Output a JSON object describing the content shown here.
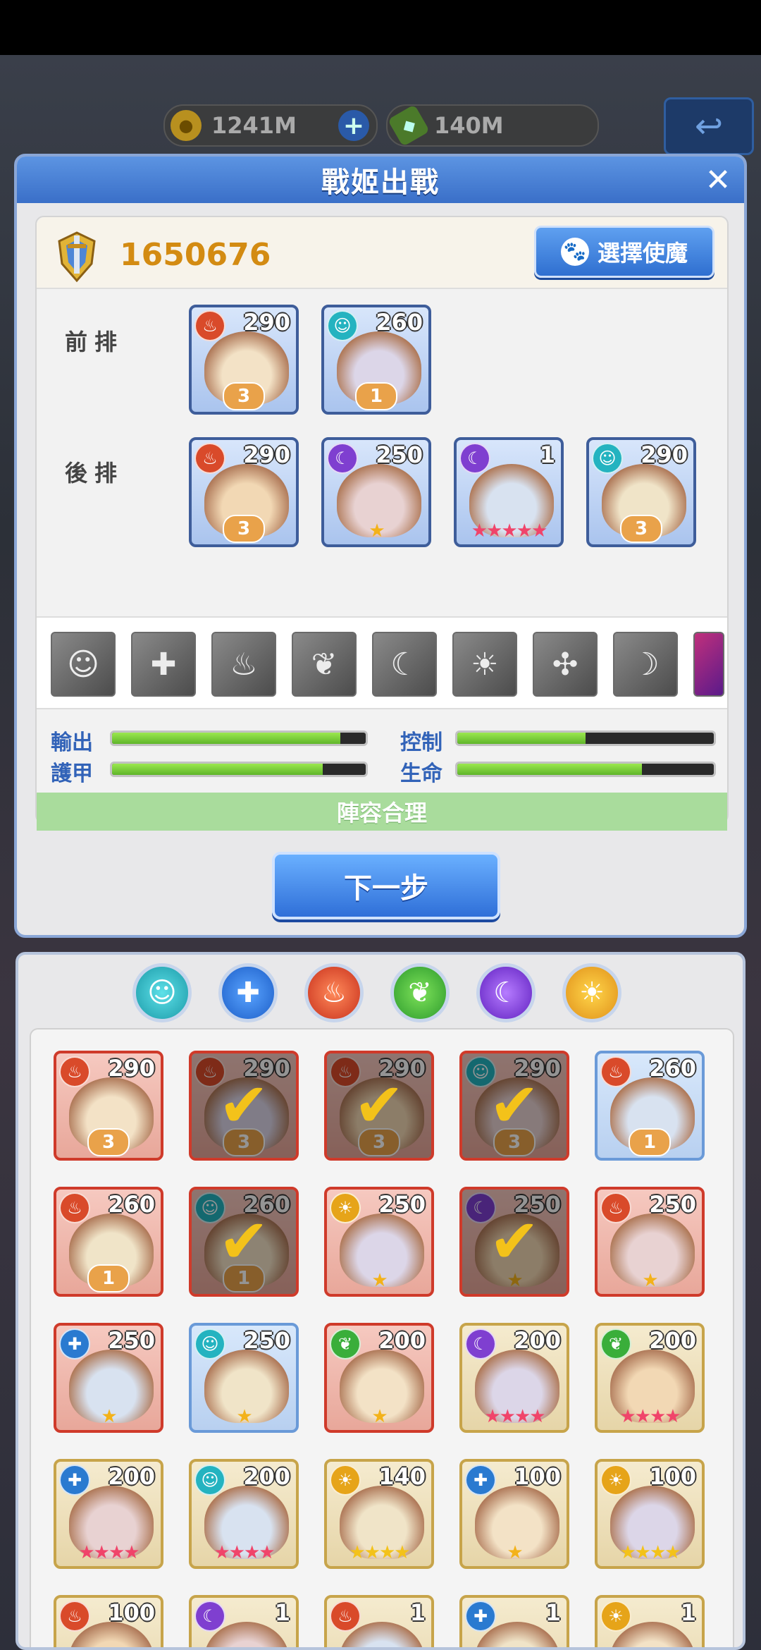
{
  "resources": {
    "gold": "1241M",
    "gems": "140M"
  },
  "panel": {
    "title": "戰姬出戰",
    "power": "1650676",
    "pet_button": "選擇使魔",
    "front_label": "前排",
    "back_label": "後排",
    "next_button": "下一步",
    "verdict": "陣容合理"
  },
  "front_row": [
    {
      "element": "fire",
      "level": "290",
      "rank": "3"
    },
    {
      "element": "water",
      "level": "260",
      "rank": "1"
    }
  ],
  "back_row": [
    {
      "element": "fire",
      "level": "290",
      "rank": "3"
    },
    {
      "element": "dark",
      "level": "250",
      "stars": "★"
    },
    {
      "element": "dark",
      "level": "1",
      "stars": "★★★★★"
    },
    {
      "element": "water",
      "level": "290",
      "rank": "3"
    }
  ],
  "skills": [
    "ghost-icon",
    "shield-cross-icon",
    "flame-icon",
    "leaf-icon",
    "moon-icon",
    "sun-icon",
    "swirl-icon",
    "moon-sun-icon"
  ],
  "stats": {
    "output": {
      "label": "輸出",
      "value": 0.9
    },
    "control": {
      "label": "控制",
      "value": 0.5
    },
    "armor": {
      "label": "護甲",
      "value": 0.83
    },
    "life": {
      "label": "生命",
      "value": 0.72
    }
  },
  "filters": [
    "water",
    "shield",
    "fire",
    "nature",
    "dark",
    "holy"
  ],
  "roster": [
    {
      "element": "fire",
      "level": "290",
      "rank": "3",
      "frame": "red",
      "selected": false
    },
    {
      "element": "fire",
      "level": "290",
      "rank": "3",
      "frame": "red",
      "selected": true
    },
    {
      "element": "fire",
      "level": "290",
      "rank": "3",
      "frame": "red",
      "selected": true
    },
    {
      "element": "water",
      "level": "290",
      "rank": "3",
      "frame": "red",
      "selected": true
    },
    {
      "element": "fire",
      "level": "260",
      "rank": "1",
      "frame": "blue",
      "selected": false
    },
    {
      "element": "fire",
      "level": "260",
      "rank": "1",
      "frame": "red",
      "selected": false
    },
    {
      "element": "water",
      "level": "260",
      "rank": "1",
      "frame": "red",
      "selected": true
    },
    {
      "element": "holy",
      "level": "250",
      "stars": "★",
      "frame": "red",
      "selected": false
    },
    {
      "element": "dark",
      "level": "250",
      "stars": "★",
      "frame": "red",
      "selected": true
    },
    {
      "element": "fire",
      "level": "250",
      "stars": "★",
      "frame": "red",
      "selected": false
    },
    {
      "element": "shield",
      "level": "250",
      "stars": "★",
      "frame": "red",
      "selected": false
    },
    {
      "element": "water",
      "level": "250",
      "stars": "★",
      "frame": "blue",
      "selected": false
    },
    {
      "element": "nature",
      "level": "200",
      "stars": "★",
      "frame": "red",
      "selected": false
    },
    {
      "element": "dark",
      "level": "200",
      "stars": "★★★★",
      "frame": "gold",
      "selected": false
    },
    {
      "element": "nature",
      "level": "200",
      "stars": "★★★★",
      "frame": "gold",
      "selected": false
    },
    {
      "element": "shield",
      "level": "200",
      "stars": "★★★★",
      "frame": "gold",
      "selected": false
    },
    {
      "element": "water",
      "level": "200",
      "stars": "★★★★",
      "frame": "gold",
      "selected": false
    },
    {
      "element": "holy",
      "level": "140",
      "stars": "★★★★",
      "frame": "gold",
      "selected": false
    },
    {
      "element": "shield",
      "level": "100",
      "stars": "★",
      "frame": "gold",
      "selected": false
    },
    {
      "element": "holy",
      "level": "100",
      "stars": "★★★★",
      "frame": "gold",
      "selected": false
    },
    {
      "element": "fire",
      "level": "100",
      "frame": "gold",
      "selected": false
    },
    {
      "element": "dark",
      "level": "1",
      "frame": "gold",
      "selected": false
    },
    {
      "element": "fire",
      "level": "1",
      "frame": "gold",
      "selected": false
    },
    {
      "element": "shield",
      "level": "1",
      "frame": "gold",
      "selected": false
    },
    {
      "element": "holy",
      "level": "1",
      "frame": "gold",
      "selected": false
    }
  ]
}
